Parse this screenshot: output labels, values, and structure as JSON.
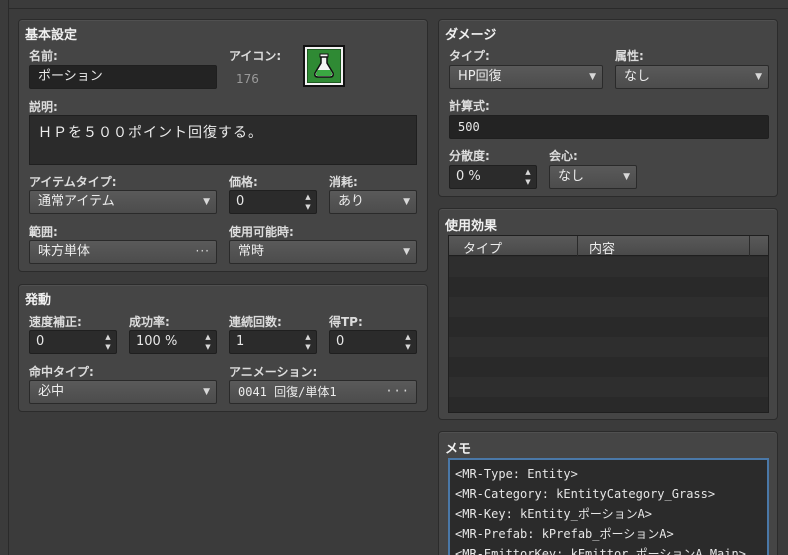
{
  "basic": {
    "title": "基本設定",
    "name_label": "名前:",
    "name_value": "ポーション",
    "icon_label": "アイコン:",
    "icon_index": "176",
    "icon_name": "potion-flask-icon",
    "desc_label": "説明:",
    "desc_value": "ＨＰを５００ポイント回復する。",
    "item_type_label": "アイテムタイプ:",
    "item_type_value": "通常アイテム",
    "price_label": "価格:",
    "price_value": "0",
    "consume_label": "消耗:",
    "consume_value": "あり",
    "scope_label": "範囲:",
    "scope_value": "味方単体",
    "occasion_label": "使用可能時:",
    "occasion_value": "常時"
  },
  "invocation": {
    "title": "発動",
    "speed_label": "速度補正:",
    "speed_value": "0",
    "success_label": "成功率:",
    "success_value": "100 %",
    "repeats_label": "連続回数:",
    "repeats_value": "1",
    "tp_label": "得TP:",
    "tp_value": "0",
    "hit_type_label": "命中タイプ:",
    "hit_type_value": "必中",
    "animation_label": "アニメーション:",
    "animation_value": "0041 回復/単体1"
  },
  "damage": {
    "title": "ダメージ",
    "type_label": "タイプ:",
    "type_value": "HP回復",
    "element_label": "属性:",
    "element_value": "なし",
    "formula_label": "計算式:",
    "formula_value": "500",
    "variance_label": "分散度:",
    "variance_value": "0 %",
    "critical_label": "会心:",
    "critical_value": "なし"
  },
  "effects": {
    "title": "使用効果",
    "col_type": "タイプ",
    "col_content": "内容"
  },
  "memo": {
    "title": "メモ",
    "lines": [
      "<MR-Type: Entity>",
      "<MR-Category: kEntityCategory_Grass>",
      "<MR-Key: kEntity_ポーションA>",
      "<MR-Prefab: kPrefab_ポーションA>",
      "<MR-EmittorKey: kEmittor_ポーションA_Main>"
    ]
  },
  "colors": {
    "panel": "#454545",
    "field": "#2b2b2b",
    "memo_focus": "#4a78a8",
    "icon_green": "#2f8a34"
  }
}
